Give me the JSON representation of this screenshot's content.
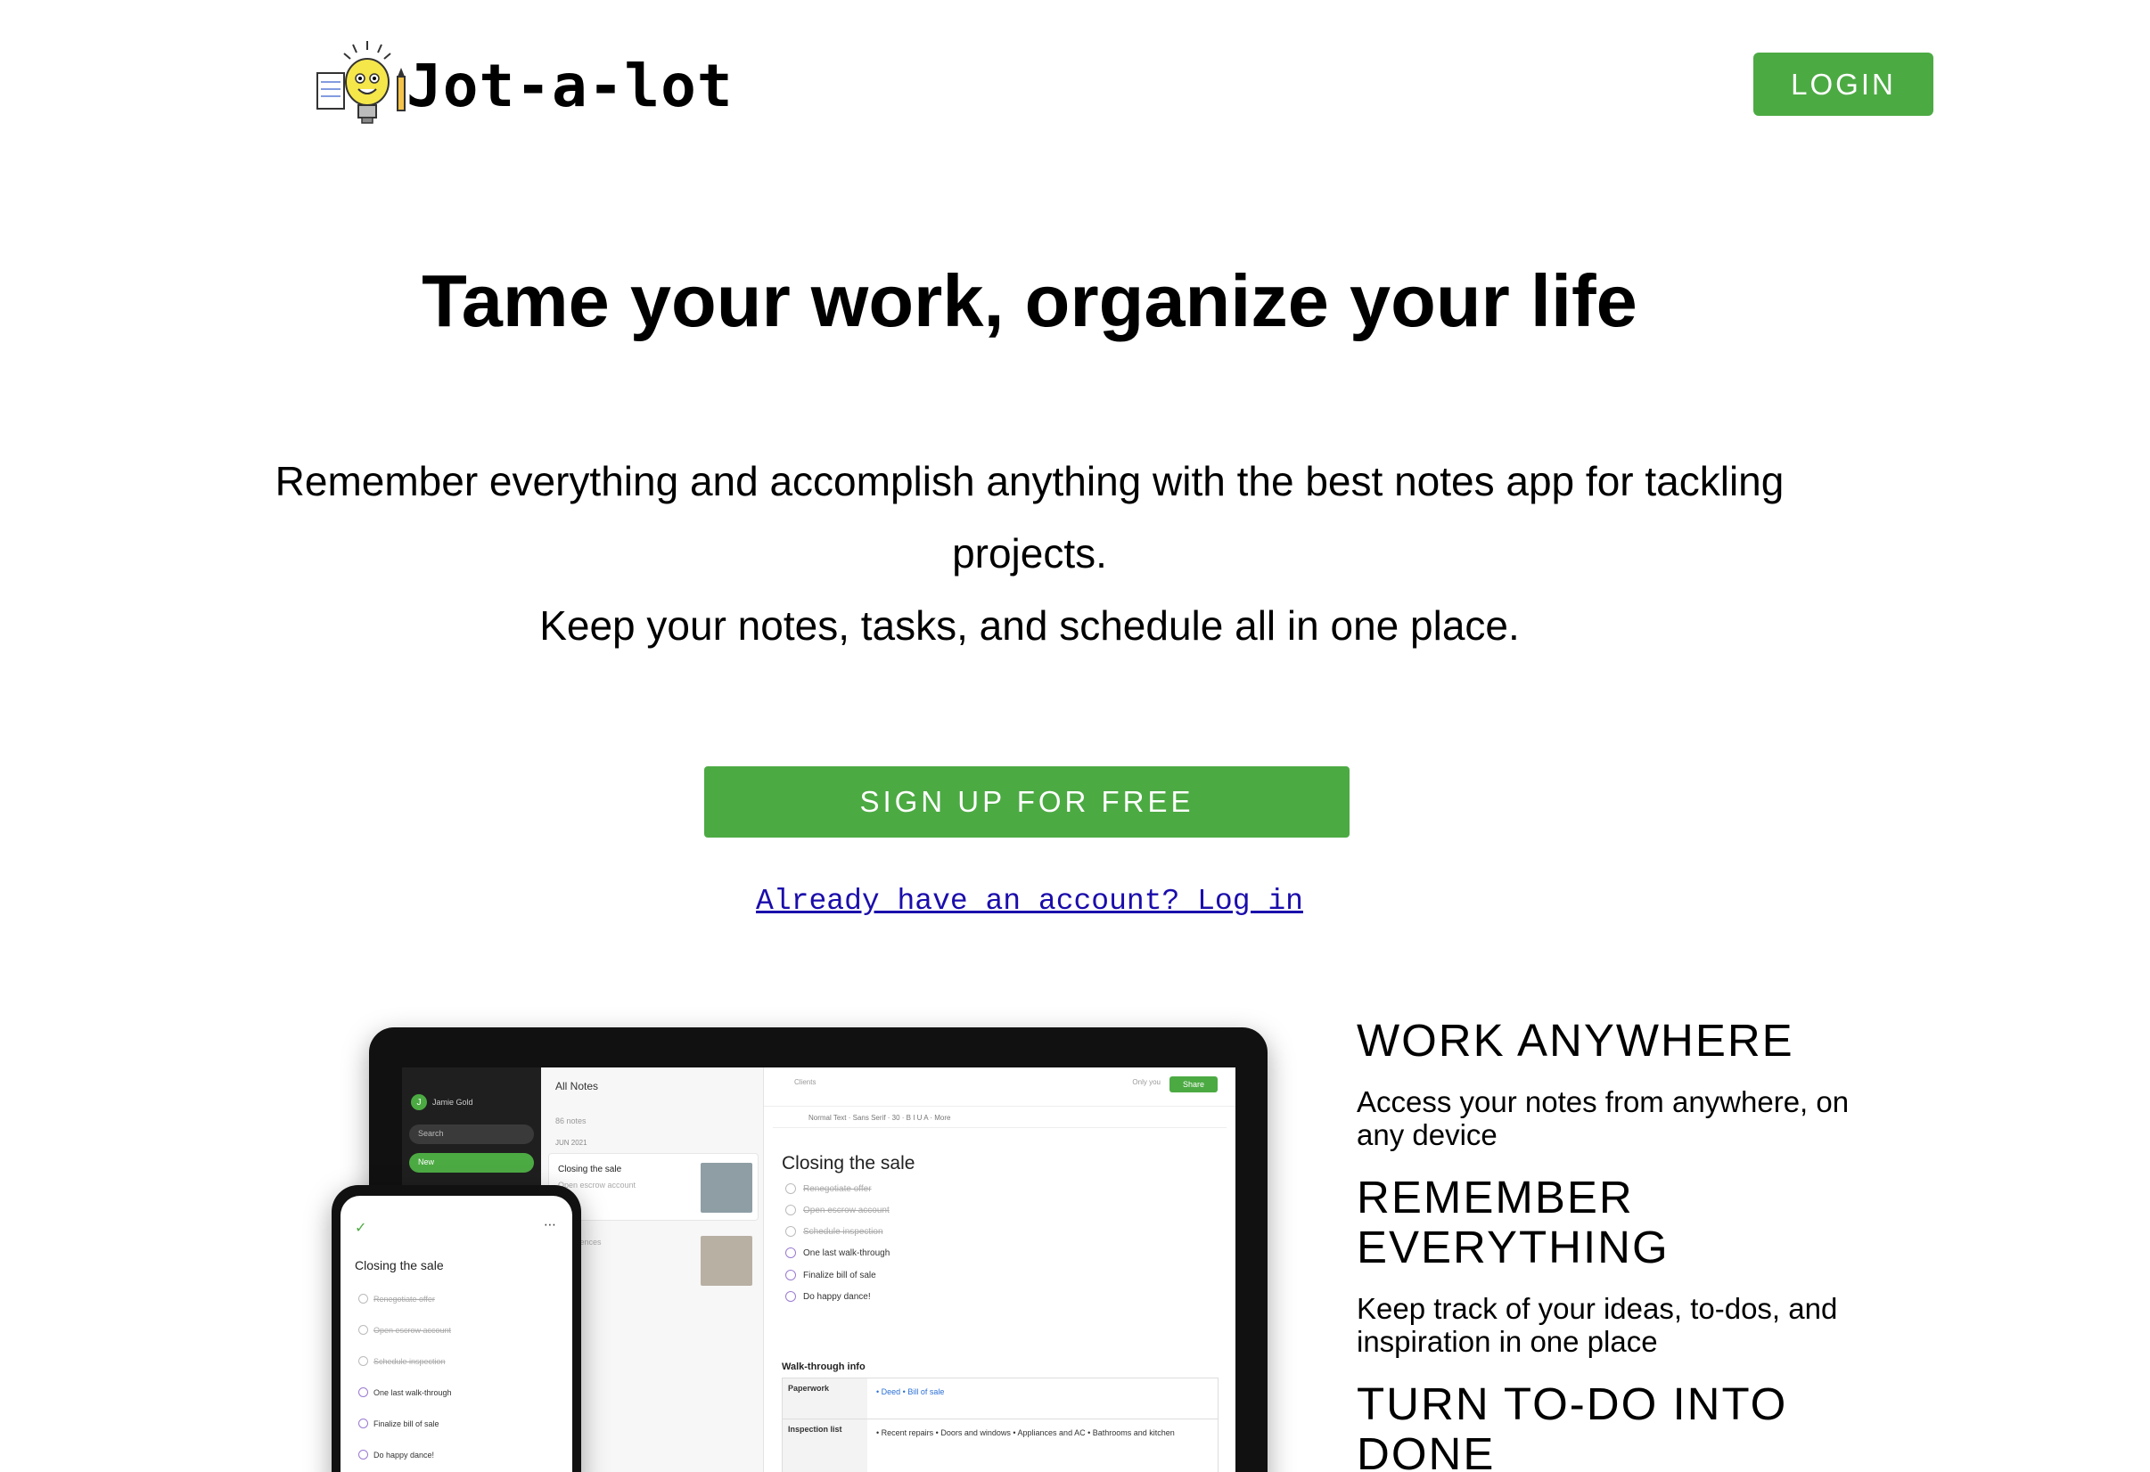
{
  "header": {
    "logo_text": "Jot-a-lot",
    "login_label": "LOGIN"
  },
  "hero": {
    "title": "Tame your work, organize your life",
    "subtitle_line1": "Remember everything and accomplish anything with the best notes app for tackling projects.",
    "subtitle_line2": "Keep your notes, tasks, and schedule all in one place.",
    "signup_label": "SIGN UP FOR FREE",
    "login_link": "Already have an account? Log in"
  },
  "features": [
    {
      "title": "WORK ANYWHERE",
      "description": "Access your notes from anywhere, on any device"
    },
    {
      "title": "REMEMBER EVERYTHING",
      "description": "Keep track of your ideas, to-dos, and inspiration in one place"
    },
    {
      "title": "TURN TO-DO INTO DONE",
      "description": ""
    }
  ],
  "mockup": {
    "user_name": "Jamie Gold",
    "search": "Search",
    "new": "New",
    "notes_header": "All Notes",
    "notes_count": "86 notes",
    "month": "JUN 2021",
    "note1_title": "Closing the sale",
    "note1_sub": "Open escrow account",
    "note2_sub": "Preferences",
    "share": "Share",
    "only_you": "Only you",
    "breadcrumb": "Clients",
    "toolbar_text": "Normal Text · Sans Serif · 30 · B I U A · More",
    "editor_title": "Closing the sale",
    "tasks": [
      {
        "label": "Renegotiate offer",
        "done": true
      },
      {
        "label": "Open escrow account",
        "done": true
      },
      {
        "label": "Schedule inspection",
        "done": true
      },
      {
        "label": "One last walk-through",
        "done": false
      },
      {
        "label": "Finalize bill of sale",
        "done": false
      },
      {
        "label": "Do happy dance!",
        "done": false
      }
    ],
    "section": "Walk-through info",
    "table_paperwork_label": "Paperwork",
    "table_paperwork_val": "• Deed  • Bill of sale",
    "table_inspection_label": "Inspection list",
    "table_inspection_val": "• Recent repairs • Doors and windows • Appliances and AC • Bathrooms and kitchen",
    "phone_title": "Closing the sale"
  },
  "colors": {
    "brand_green": "#4caa43",
    "link_blue": "#1a0dab"
  }
}
